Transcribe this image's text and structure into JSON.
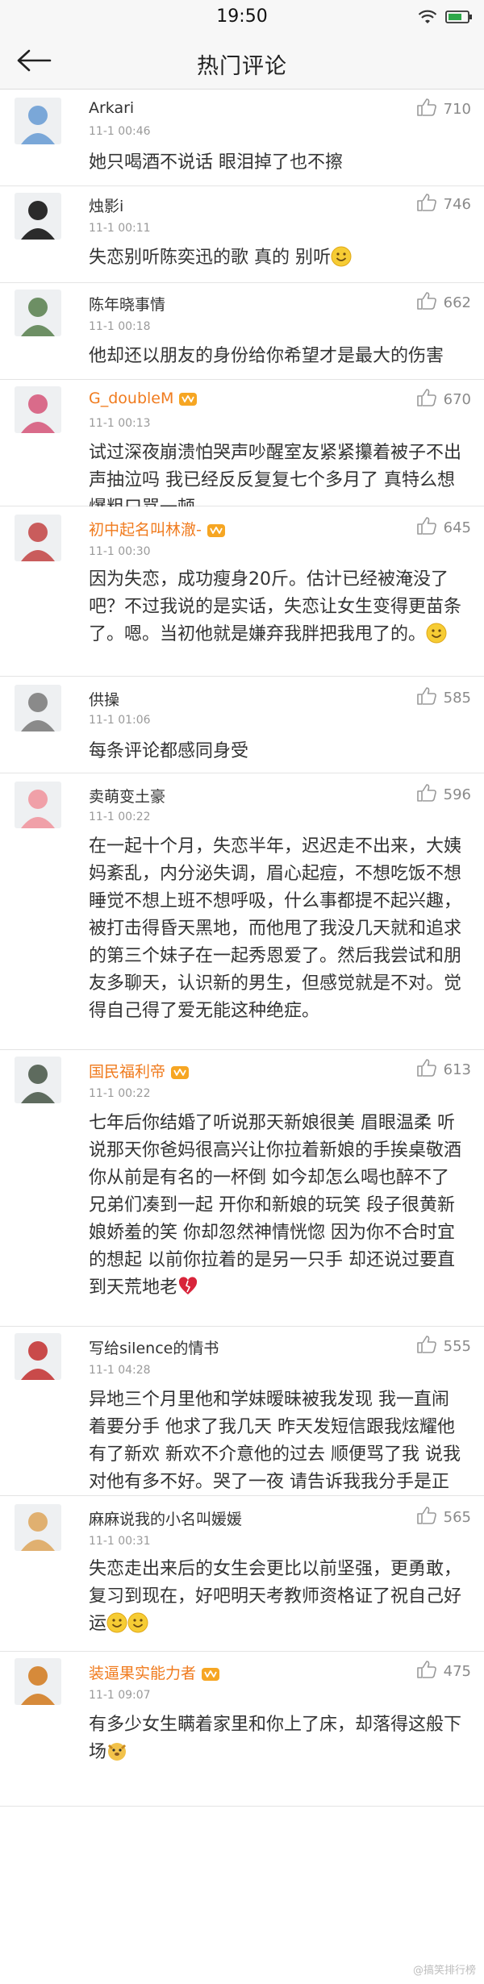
{
  "status_bar": {
    "time": "19:50"
  },
  "nav": {
    "title": "热门评论"
  },
  "comments": [
    {
      "user": "Arkari",
      "time": "11-1 00:46",
      "likes": "710",
      "text": "她只喝酒不说话 眼泪掉了也不擦"
    },
    {
      "user": "烛影i",
      "time": "11-1 00:11",
      "likes": "746",
      "text": "失恋别听陈奕迅的歌 真的 别听"
    },
    {
      "user": "陈年晓事情",
      "time": "11-1 00:18",
      "likes": "662",
      "text": "他却还以朋友的身份给你希望才是最大的伤害"
    },
    {
      "user": "G_doubleM",
      "time": "11-1 00:13",
      "likes": "670",
      "text": "试过深夜崩溃怕哭声吵醒室友紧紧攥着被子不出声抽泣吗 我已经反反复复七个多月了 真特么想爆粗口骂一顿"
    },
    {
      "user": "初中起名叫林澈-",
      "time": "11-1 00:30",
      "likes": "645",
      "text": "因为失恋，成功瘦身20斤。估计已经被淹没了吧？不过我说的是实话，失恋让女生变得更苗条了。嗯。当初他就是嫌弃我胖把我甩了的。"
    },
    {
      "user": "供操",
      "time": "11-1 01:06",
      "likes": "585",
      "text": "每条评论都感同身受"
    },
    {
      "user": "卖萌变土豪",
      "time": "11-1 00:22",
      "likes": "596",
      "text": "在一起十个月，失恋半年，迟迟走不出来，大姨妈紊乱，内分泌失调，眉心起痘，不想吃饭不想睡觉不想上班不想呼吸，什么事都提不起兴趣，被打击得昏天黑地，而他甩了我没几天就和追求的第三个妹子在一起秀恩爱了。然后我尝试和朋友多聊天，认识新的男生，但感觉就是不对。觉得自己得了爱无能这种绝症。"
    },
    {
      "user": "国民福利帝",
      "time": "11-1 00:22",
      "likes": "613",
      "text": "七年后你结婚了听说那天新娘很美 眉眼温柔 听说那天你爸妈很高兴让你拉着新娘的手挨桌敬酒你从前是有名的一杯倒 如今却怎么喝也醉不了 兄弟们凑到一起 开你和新娘的玩笑 段子很黄新娘娇羞的笑 你却忽然神情恍惚 因为你不合时宜的想起 以前你拉着的是另一只手 却还说过要直到天荒地老"
    },
    {
      "user": "写给silence的情书",
      "time": "11-1 04:28",
      "likes": "555",
      "text": "异地三个月里他和学妹暧昧被我发现 我一直闹着要分手 他求了我几天 昨天发短信跟我炫耀他有了新欢 新欢不介意他的过去 顺便骂了我 说我对他有多不好。哭了一夜 请告诉我我分手是正确的。"
    },
    {
      "user": "麻麻说我的小名叫媛媛",
      "time": "11-1 00:31",
      "likes": "565",
      "text": "失恋走出来后的女生会更比以前坚强，更勇敢，复习到现在，好吧明天考教师资格证了祝自己好运"
    },
    {
      "user": "装逼果实能力者",
      "time": "11-1 09:07",
      "likes": "475",
      "text": "有多少女生瞒着家里和你上了床，却落得这般下场"
    }
  ],
  "watermark": {
    "text": "@搞笑排行榜"
  },
  "colors": {
    "vip_name": "#f07b1e",
    "text": "#333333",
    "meta": "#9a9a9a",
    "divider": "#e4e4e4"
  },
  "icons": {
    "back": "back-arrow-icon",
    "like": "thumbs-up-icon",
    "vip": "vip-crown-icon"
  }
}
